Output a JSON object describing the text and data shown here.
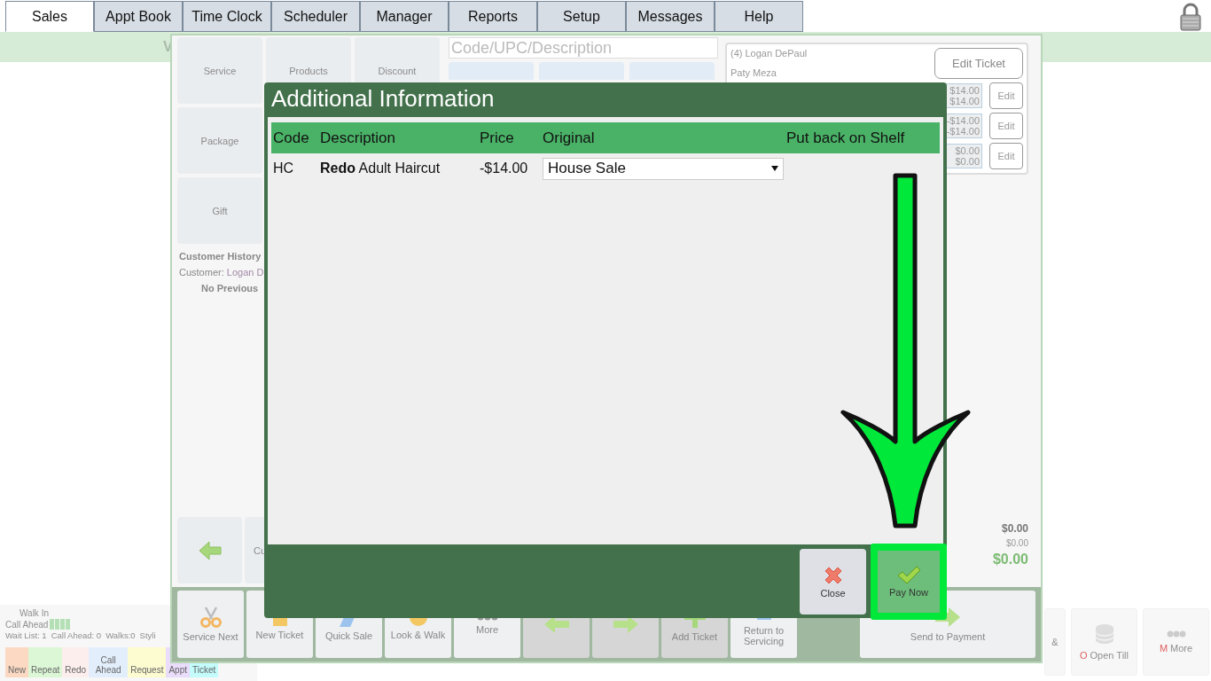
{
  "nav_tabs": [
    {
      "label": "Sales",
      "selected": true
    },
    {
      "label": "Appt Book",
      "selected": false
    },
    {
      "label": "Time Clock",
      "selected": false
    },
    {
      "label": "Scheduler",
      "selected": false
    },
    {
      "label": "Manager",
      "selected": false
    },
    {
      "label": "Reports",
      "selected": false
    },
    {
      "label": "Setup",
      "selected": false
    },
    {
      "label": "Messages",
      "selected": false
    },
    {
      "label": "Help",
      "selected": false
    }
  ],
  "banner": {
    "text": "V"
  },
  "categories": [
    "Service",
    "Products",
    "Discount",
    "Package",
    "Gift"
  ],
  "customer_history": {
    "title": "Customer History",
    "customer_label": "Customer:",
    "customer": "Logan D",
    "note": "No Previous"
  },
  "search": {
    "placeholder": "Code/UPC/Description"
  },
  "lower_buttons": [
    {
      "kind": "back"
    },
    {
      "kind": "text",
      "label": "Cu"
    }
  ],
  "ticket": {
    "customer": "(4) Logan DePaul",
    "stylist": "Paty Meza",
    "edit_button": "Edit Ticket",
    "lines": [
      {
        "amount": "$14.00",
        "total": "$14.00",
        "button": "Edit"
      },
      {
        "amount": "-$14.00",
        "total": "-$14.00",
        "button": "Edit"
      },
      {
        "amount": "$0.00",
        "total": "$0.00",
        "button": "Edit"
      }
    ]
  },
  "totals": {
    "subtotal": "$0.00",
    "tax": "$0.00",
    "total": "$0.00"
  },
  "toolbar": [
    {
      "kind": "scissors",
      "label": "Service Next",
      "disabled": false
    },
    {
      "kind": "ticket",
      "label": "New Ticket",
      "disabled": false
    },
    {
      "kind": "quick",
      "label": "Quick Sale",
      "disabled": false
    },
    {
      "kind": "walk",
      "label": "Look & Walk",
      "disabled": false
    },
    {
      "kind": "more",
      "label": "More",
      "disabled": false
    },
    {
      "kind": "back",
      "disabled": true
    },
    {
      "kind": "forward",
      "disabled": true
    },
    {
      "kind": "add",
      "label": "Add Ticket",
      "disabled": true
    },
    {
      "kind": "return",
      "label": "Return to Servicing",
      "disabled": false
    }
  ],
  "payment_button": {
    "label": "Send to Payment"
  },
  "queue": {
    "walk_in": "Walk In",
    "call_ahead": "Call Ahead",
    "stats": [
      "Wait List: 1",
      "Call Ahead: 0",
      "Walks:0",
      "Styli"
    ]
  },
  "legend": [
    {
      "label": "New",
      "color": "#fbd9c2"
    },
    {
      "label": "Repeat",
      "color": "#dcf7d6"
    },
    {
      "label": "Redo",
      "color": "#fdeeee"
    },
    {
      "label": "Call Ahead",
      "color": "#e2eefb"
    },
    {
      "label": "Request",
      "color": "#fdfbd0"
    },
    {
      "label": "Appt",
      "color": "#eadcfb"
    },
    {
      "label": "Ticket",
      "color": "#c4fbfb"
    }
  ],
  "side_buttons": [
    {
      "kind": "partial",
      "label": "&"
    },
    {
      "kind": "till",
      "hotkey": "O",
      "label": "Open Till"
    },
    {
      "kind": "more",
      "hotkey": "M",
      "label": "More"
    }
  ],
  "modal": {
    "title": "Additional Information",
    "columns": [
      "Code",
      "Description",
      "Price",
      "Original",
      "Put back on Shelf"
    ],
    "rows": [
      {
        "code": "HC",
        "description": "**Redo** Adult Haircut",
        "price": "-$14.00",
        "original": "House Sale"
      }
    ],
    "buttons": [
      {
        "kind": "close",
        "label": "Close",
        "highlighted": false
      },
      {
        "kind": "pay",
        "label": "Pay Now",
        "highlighted": true
      }
    ]
  }
}
